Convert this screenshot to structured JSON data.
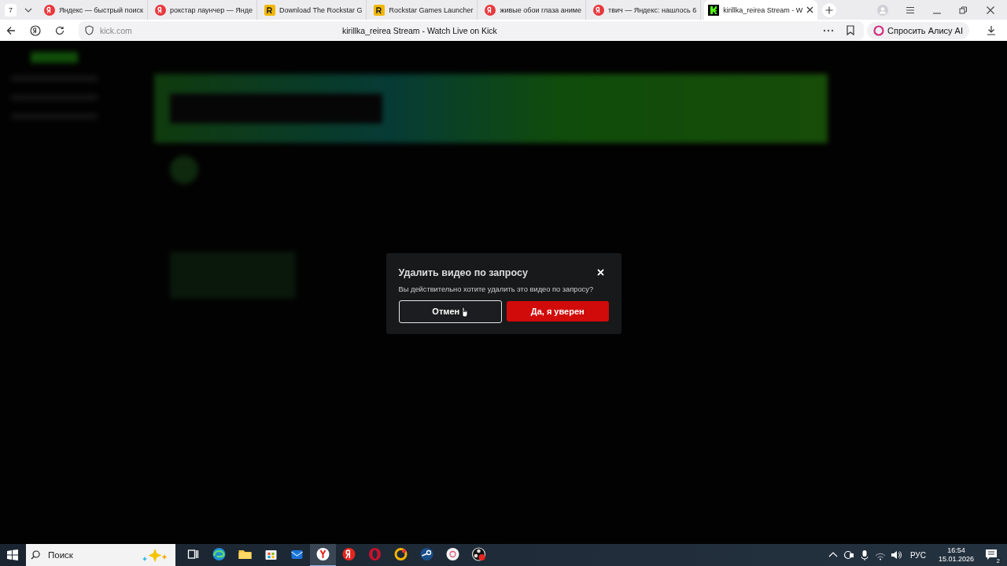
{
  "browser": {
    "tab_count": "7",
    "tabs": [
      {
        "title": "Яндекс — быстрый поиск",
        "kind": "yandex",
        "selected": false
      },
      {
        "title": "рокстар лаунчер — Янде",
        "kind": "yandex",
        "selected": false
      },
      {
        "title": "Download The Rockstar G",
        "kind": "rockstar",
        "selected": false
      },
      {
        "title": "Rockstar Games Launcher",
        "kind": "rockstar",
        "selected": false
      },
      {
        "title": "живые обои глаза аниме",
        "kind": "yandex",
        "selected": false
      },
      {
        "title": "твич — Яндекс: нашлось 6",
        "kind": "yandex",
        "selected": false
      },
      {
        "title": "kirillka_reirea Stream - W",
        "kind": "kick",
        "selected": true
      }
    ],
    "address": {
      "url": "kick.com",
      "page_title": "kirillka_reirea Stream - Watch Live on Kick"
    },
    "alice_button": "Спросить Алису AI"
  },
  "dialog": {
    "title": "Удалить видео по запросу",
    "message": "Вы действительно хотите удалить это видео по запросу?",
    "cancel_button": "Отмен",
    "confirm_button": "Да, я уверен"
  },
  "taskbar": {
    "search": {
      "placeholder": "Поиск"
    },
    "apps": [
      {
        "kind": "taskview",
        "active": false
      },
      {
        "kind": "edge",
        "active": false
      },
      {
        "kind": "folder",
        "active": false
      },
      {
        "kind": "store",
        "active": false
      },
      {
        "kind": "mail",
        "active": false
      },
      {
        "kind": "ybrowser",
        "active": true
      },
      {
        "kind": "yandex",
        "active": false
      },
      {
        "kind": "opera",
        "active": false
      },
      {
        "kind": "ring",
        "active": false
      },
      {
        "kind": "steam",
        "active": false
      },
      {
        "kind": "disc",
        "active": false
      },
      {
        "kind": "obs",
        "active": false
      }
    ],
    "language": "РУС",
    "time": "16:54",
    "date": "15.01.2026",
    "notifications": "2"
  }
}
